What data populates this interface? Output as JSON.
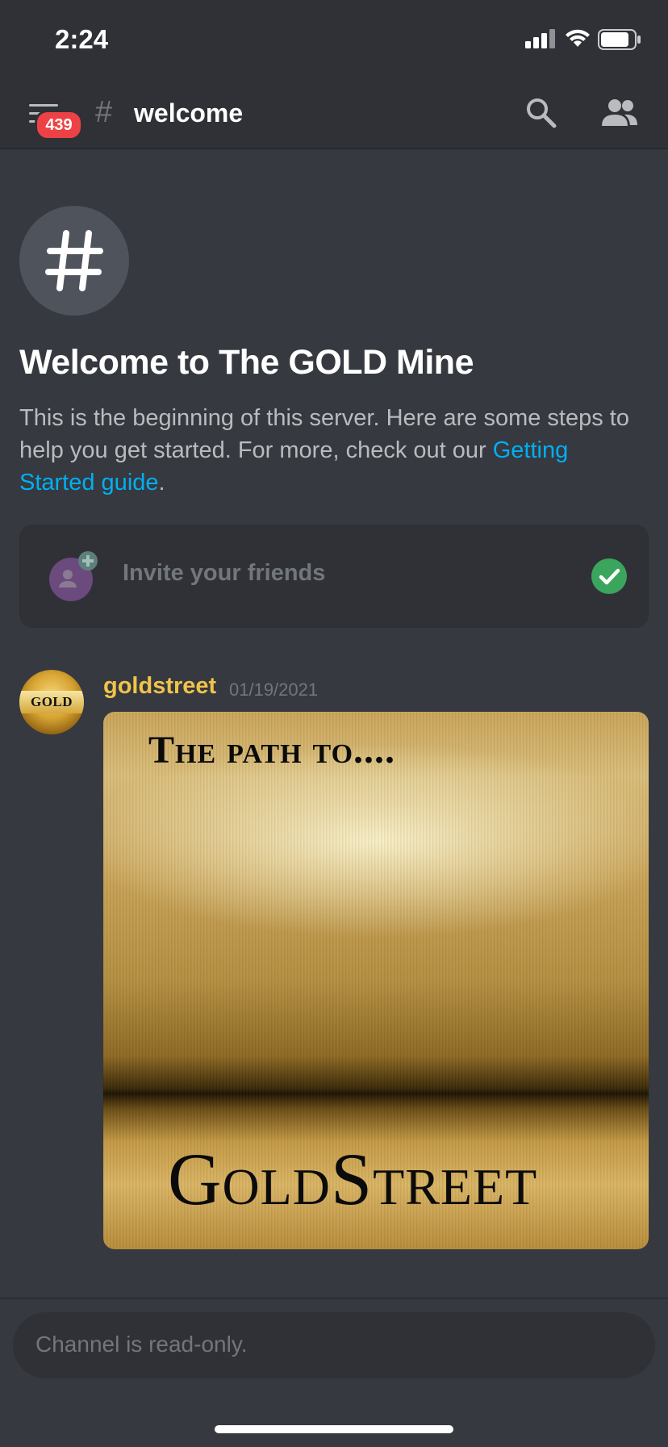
{
  "status_bar": {
    "time": "2:24"
  },
  "header": {
    "unread_badge": "439",
    "hash_symbol": "#",
    "channel_name": "welcome"
  },
  "hero": {
    "icon_glyph": "#",
    "title": "Welcome to The GOLD Mine",
    "description_prefix": "This is the beginning of this server. Here are some steps to help you get started. For more, check out our ",
    "description_link": "Getting Started guide",
    "description_suffix": "."
  },
  "steps": [
    {
      "label": "Invite your friends",
      "completed": true
    }
  ],
  "message": {
    "author": "goldstreet",
    "date": "01/19/2021",
    "avatar_text": "GOLD",
    "attachment": {
      "top_text": "The path to....",
      "bottom_text": "GoldStreet"
    }
  },
  "composer": {
    "placeholder": "Channel is read-only."
  },
  "colors": {
    "background": "#36393f",
    "header_bg": "#2f3136",
    "badge": "#ed4245",
    "link": "#00aff4",
    "author": "#f0c44a",
    "check": "#3ba55d"
  }
}
